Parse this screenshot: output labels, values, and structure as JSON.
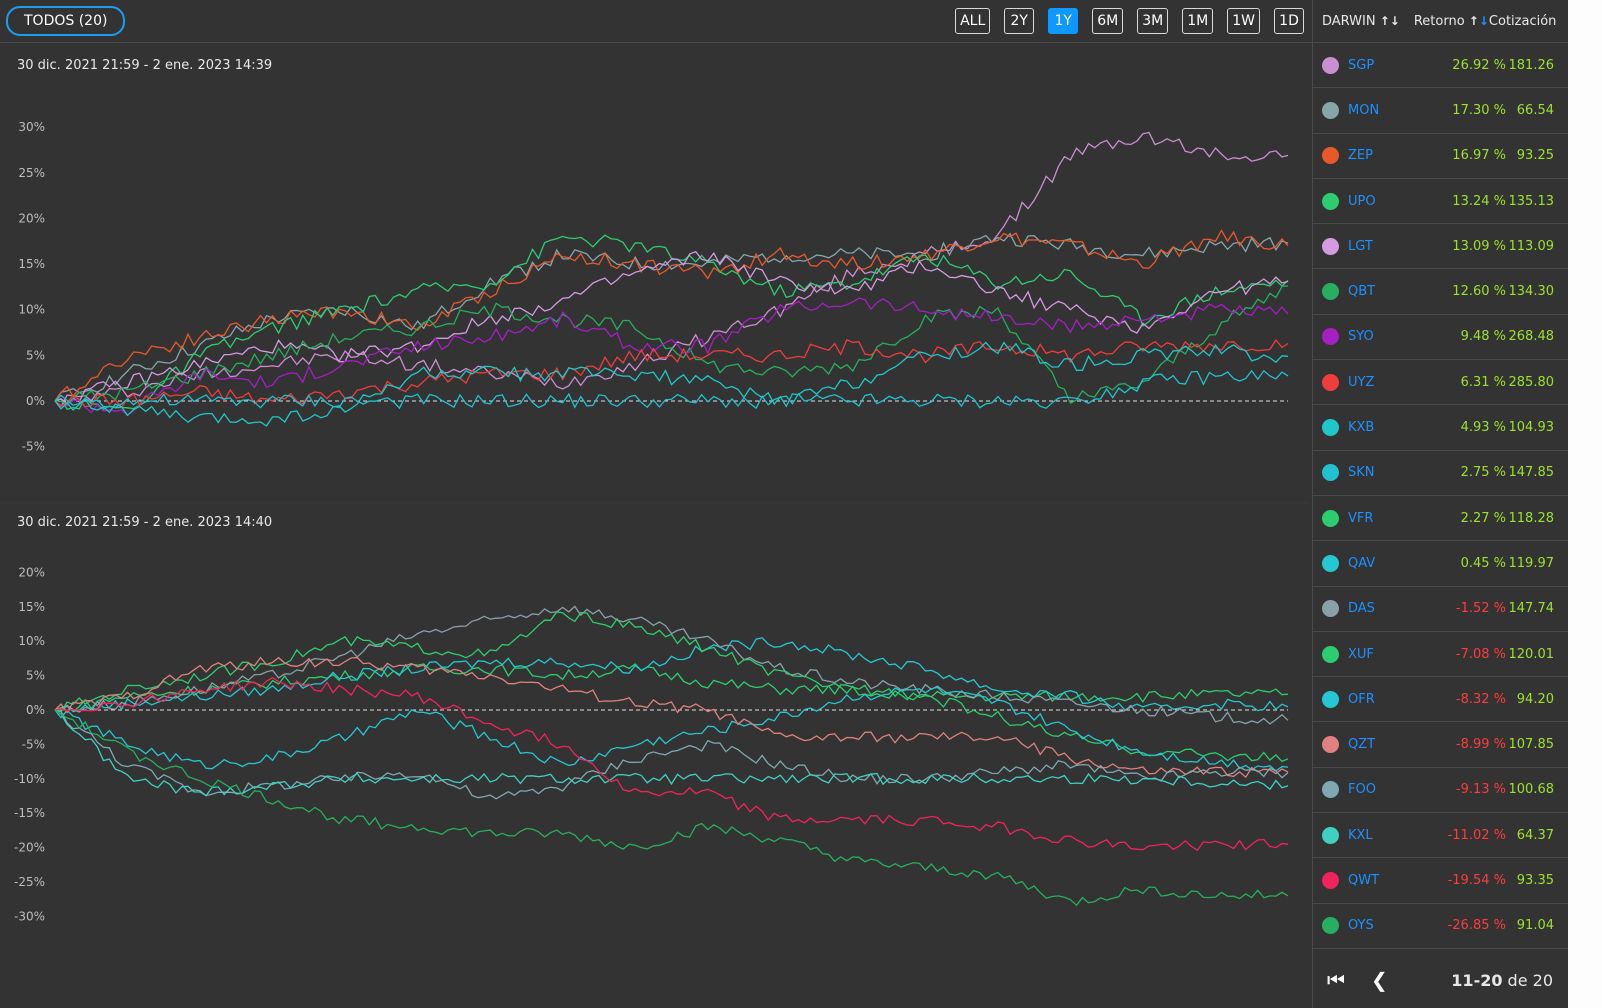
{
  "topbar": {
    "all_button": "TODOS (20)",
    "ranges": [
      {
        "label": "ALL",
        "active": false
      },
      {
        "label": "2Y",
        "active": false
      },
      {
        "label": "1Y",
        "active": true
      },
      {
        "label": "6M",
        "active": false
      },
      {
        "label": "3M",
        "active": false
      },
      {
        "label": "1M",
        "active": false
      },
      {
        "label": "1W",
        "active": false
      },
      {
        "label": "1D",
        "active": false
      }
    ]
  },
  "table": {
    "headers": {
      "darwin": "DARWIN",
      "return": "Retorno",
      "quote": "Cotización"
    },
    "rows": [
      {
        "name": "SGP",
        "ret": "26.92 %",
        "quote": "181.26",
        "color": "#c98fd0",
        "neg": false
      },
      {
        "name": "MON",
        "ret": "17.30 %",
        "quote": "66.54",
        "color": "#86a6aa",
        "neg": false
      },
      {
        "name": "ZEP",
        "ret": "16.97 %",
        "quote": "93.25",
        "color": "#e8592a",
        "neg": false
      },
      {
        "name": "UPO",
        "ret": "13.24 %",
        "quote": "135.13",
        "color": "#2ecc71",
        "neg": false
      },
      {
        "name": "LGT",
        "ret": "13.09 %",
        "quote": "113.09",
        "color": "#d39be0",
        "neg": false
      },
      {
        "name": "QBT",
        "ret": "12.60 %",
        "quote": "134.30",
        "color": "#27ae60",
        "neg": false
      },
      {
        "name": "SYO",
        "ret": "9.48 %",
        "quote": "268.48",
        "color": "#a61ec4",
        "neg": false
      },
      {
        "name": "UYZ",
        "ret": "6.31 %",
        "quote": "285.80",
        "color": "#f03c3c",
        "neg": false
      },
      {
        "name": "KXB",
        "ret": "4.93 %",
        "quote": "104.93",
        "color": "#1fc8c8",
        "neg": false
      },
      {
        "name": "SKN",
        "ret": "2.75 %",
        "quote": "147.85",
        "color": "#22c0d0",
        "neg": false
      },
      {
        "name": "VFR",
        "ret": "2.27 %",
        "quote": "118.28",
        "color": "#2ecc71",
        "neg": false
      },
      {
        "name": "QAV",
        "ret": "0.45 %",
        "quote": "119.97",
        "color": "#25c8d0",
        "neg": false
      },
      {
        "name": "DAS",
        "ret": "-1.52 %",
        "quote": "147.74",
        "color": "#8aa0a8",
        "neg": true
      },
      {
        "name": "XUF",
        "ret": "-7.08 %",
        "quote": "120.01",
        "color": "#2ecc71",
        "neg": true
      },
      {
        "name": "OFR",
        "ret": "-8.32 %",
        "quote": "94.20",
        "color": "#25c8d0",
        "neg": true
      },
      {
        "name": "QZT",
        "ret": "-8.99 %",
        "quote": "107.85",
        "color": "#e08080",
        "neg": true
      },
      {
        "name": "FOO",
        "ret": "-9.13 %",
        "quote": "100.68",
        "color": "#80a8b0",
        "neg": true
      },
      {
        "name": "KXL",
        "ret": "-11.02 %",
        "quote": "64.37",
        "color": "#40d0c0",
        "neg": true
      },
      {
        "name": "QWT",
        "ret": "-19.54 %",
        "quote": "93.35",
        "color": "#f0245a",
        "neg": true
      },
      {
        "name": "OYS",
        "ret": "-26.85 %",
        "quote": "91.04",
        "color": "#27ae60",
        "neg": true
      }
    ],
    "pagination": {
      "range": "11-20",
      "suffix": " de 20"
    }
  },
  "chart_data": [
    {
      "type": "line",
      "title": "30 dic. 2021 21:59 - 2 ene. 2023 14:39",
      "ylim": [
        -6,
        32
      ],
      "yticks": [
        30,
        25,
        20,
        15,
        10,
        5,
        0,
        -5
      ],
      "ytick_labels": [
        "30%",
        "25%",
        "20%",
        "15%",
        "10%",
        "5%",
        "0%",
        "-5%"
      ],
      "baseline": 0,
      "series": [
        {
          "name": "SGP",
          "color": "#c98fd0",
          "values": [
            0,
            1,
            3,
            4,
            5,
            4,
            3,
            2,
            4,
            7,
            10,
            14,
            16,
            18,
            27,
            29,
            27,
            26.9
          ]
        },
        {
          "name": "MON",
          "color": "#86a6aa",
          "values": [
            0,
            3,
            6,
            9,
            10,
            8,
            13,
            16,
            15,
            15,
            16,
            16,
            16,
            18,
            17,
            16,
            17,
            17.3
          ]
        },
        {
          "name": "ZEP",
          "color": "#e8592a",
          "values": [
            0,
            5,
            7,
            9,
            10,
            8,
            12,
            16,
            15,
            14,
            16,
            15,
            16,
            18,
            17,
            15,
            18,
            17
          ]
        },
        {
          "name": "UPO",
          "color": "#2ecc71",
          "values": [
            0,
            -1,
            5,
            8,
            10,
            12,
            13,
            18,
            17,
            15,
            12,
            13,
            16,
            13,
            14,
            9,
            12,
            13.2
          ]
        },
        {
          "name": "LGT",
          "color": "#d39be0",
          "values": [
            0,
            2,
            4,
            6,
            5,
            6,
            9,
            11,
            14,
            16,
            13,
            12,
            15,
            12,
            10,
            8,
            12,
            13.1
          ]
        },
        {
          "name": "QBT",
          "color": "#27ae60",
          "values": [
            0,
            1,
            3,
            5,
            7,
            8,
            10,
            9,
            8,
            4,
            3,
            4,
            9,
            10,
            0,
            2,
            8,
            12.6
          ]
        },
        {
          "name": "SYO",
          "color": "#a61ec4",
          "values": [
            0,
            -1,
            3,
            2,
            4,
            6,
            7,
            9,
            6,
            6,
            10,
            11,
            10,
            9,
            8,
            9,
            10,
            9.5
          ]
        },
        {
          "name": "UYZ",
          "color": "#f03c3c",
          "values": [
            0,
            0,
            1,
            0,
            1,
            2,
            3,
            3,
            5,
            5,
            5,
            6,
            5,
            6,
            5,
            6,
            6.2,
            6.3
          ]
        },
        {
          "name": "KXB",
          "color": "#1fc8c8",
          "values": [
            0,
            -1,
            -2,
            -2,
            -1,
            3,
            3,
            3,
            3,
            2,
            0,
            2,
            5,
            6,
            4,
            5,
            5.5,
            4.9
          ]
        },
        {
          "name": "SKN",
          "color": "#22c0d0",
          "values": [
            0,
            0,
            0,
            0,
            0,
            0,
            0,
            0,
            0,
            0,
            0,
            0,
            0,
            0,
            0,
            2,
            2.7,
            2.75
          ]
        }
      ]
    },
    {
      "type": "line",
      "title": "30 dic. 2021 21:59 - 2 ene. 2023 14:40",
      "ylim": [
        -32,
        22
      ],
      "yticks": [
        20,
        15,
        10,
        5,
        0,
        -5,
        -10,
        -15,
        -20,
        -25,
        -30
      ],
      "ytick_labels": [
        "20%",
        "15%",
        "10%",
        "5%",
        "0%",
        "-5%",
        "-10%",
        "-15%",
        "-20%",
        "-25%",
        "-30%"
      ],
      "baseline": 0,
      "series": [
        {
          "name": "VFR",
          "color": "#2ecc71",
          "values": [
            0,
            2,
            3,
            4,
            5,
            6,
            6,
            5,
            6,
            4,
            3,
            3,
            2,
            2,
            2,
            2,
            2.3,
            2.3
          ]
        },
        {
          "name": "QAV",
          "color": "#25c8d0",
          "values": [
            0,
            1,
            2,
            3,
            5,
            6,
            7,
            7,
            6,
            9,
            10,
            8,
            6,
            3,
            2,
            0,
            1,
            0.45
          ]
        },
        {
          "name": "DAS",
          "color": "#8aa0a8",
          "values": [
            0,
            1,
            3,
            5,
            8,
            11,
            13,
            15,
            13,
            10,
            6,
            4,
            3,
            2,
            1,
            0,
            -1,
            -1.5
          ]
        },
        {
          "name": "XUF",
          "color": "#2ecc71",
          "values": [
            0,
            3,
            5,
            7,
            10,
            9,
            8,
            14,
            12,
            9,
            5,
            3,
            2,
            -1,
            -4,
            -6,
            -6.5,
            -7.1
          ]
        },
        {
          "name": "OFR",
          "color": "#25c8d0",
          "values": [
            0,
            -5,
            -8,
            -7,
            -4,
            0,
            -4,
            -8,
            -5,
            -3,
            -1,
            2,
            3,
            1,
            -3,
            -6,
            -7.5,
            -8.3
          ]
        },
        {
          "name": "QZT",
          "color": "#e08080",
          "values": [
            0,
            2,
            6,
            7,
            7,
            6,
            5,
            3,
            1,
            0,
            -4,
            -4,
            -4,
            -4,
            -7,
            -9,
            -9,
            -9
          ]
        },
        {
          "name": "FOO",
          "color": "#80a8b0",
          "values": [
            0,
            -8,
            -12,
            -11,
            -10,
            -9,
            -13,
            -11,
            -7,
            -5,
            -8,
            -10,
            -10,
            -9,
            -8,
            -10,
            -9,
            -9.1
          ]
        },
        {
          "name": "KXL",
          "color": "#40d0c0",
          "values": [
            0,
            -10,
            -12,
            -11,
            -10,
            -10,
            -10,
            -10,
            -10,
            -10,
            -10,
            -10,
            -10,
            -10,
            -10,
            -10,
            -10.5,
            -11
          ]
        },
        {
          "name": "QWT",
          "color": "#f0245a",
          "values": [
            0,
            1,
            3,
            4,
            3,
            2,
            -2,
            -5,
            -12,
            -12,
            -16,
            -16,
            -16,
            -17,
            -19,
            -20,
            -19.5,
            -19.5
          ]
        },
        {
          "name": "OYS",
          "color": "#27ae60",
          "values": [
            0,
            -6,
            -10,
            -13,
            -16,
            -17,
            -18,
            -18,
            -20,
            -17,
            -19,
            -22,
            -23,
            -24,
            -28,
            -26,
            -27,
            -27
          ]
        }
      ]
    }
  ]
}
